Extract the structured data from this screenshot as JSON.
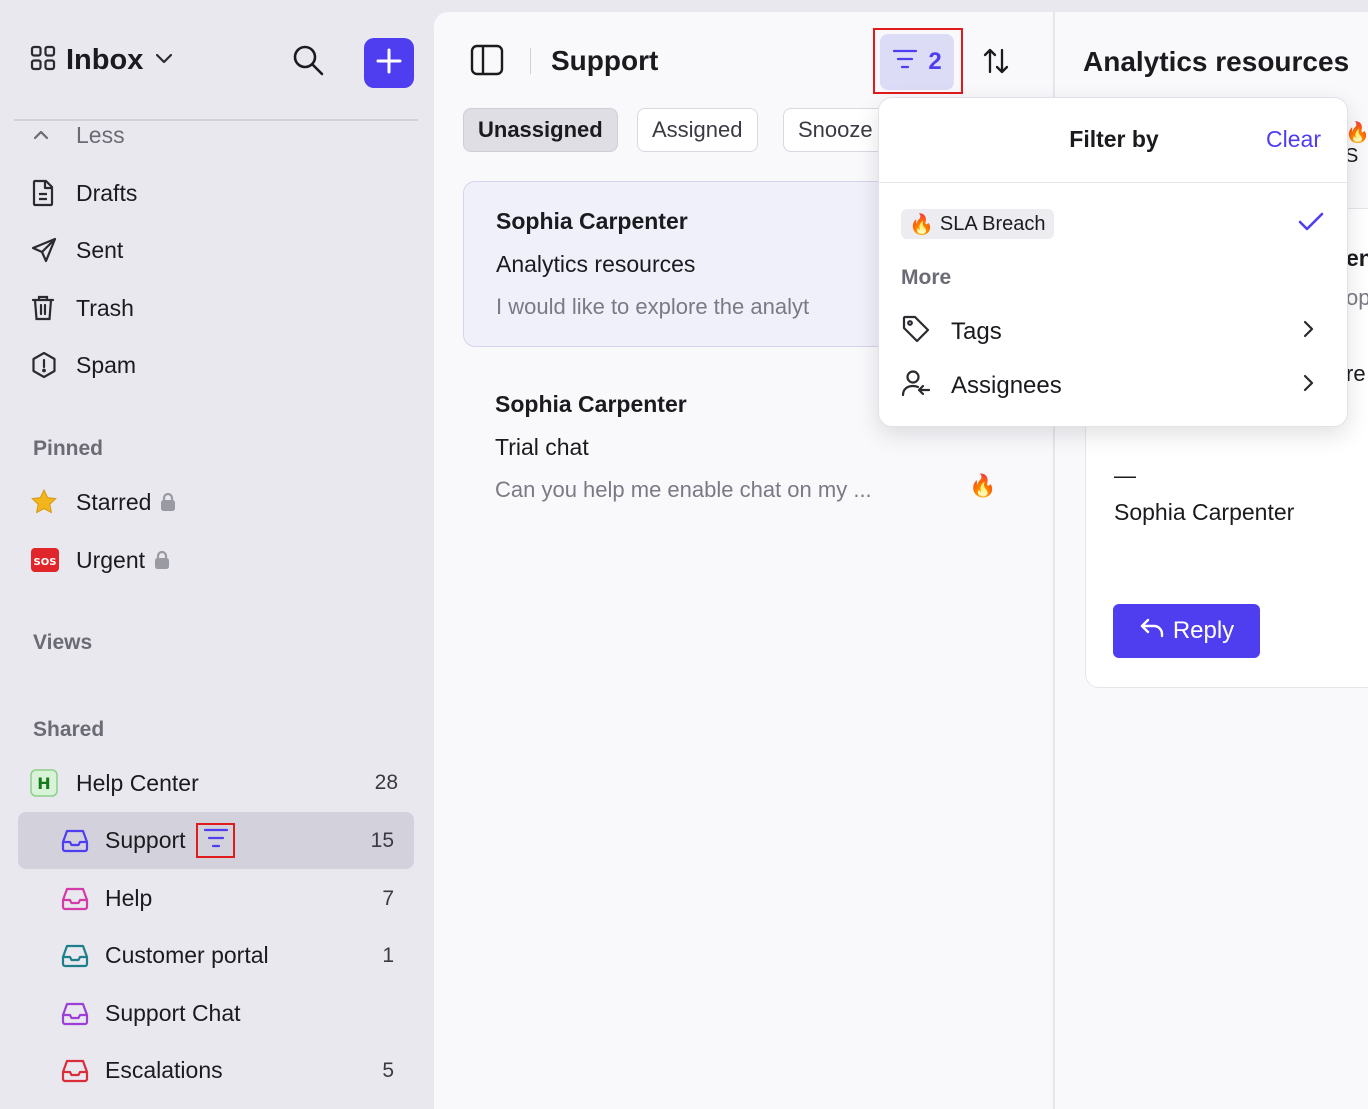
{
  "sidebar": {
    "inbox_title": "Inbox",
    "less_label": "Less",
    "items": [
      {
        "label": "Drafts"
      },
      {
        "label": "Sent"
      },
      {
        "label": "Trash"
      },
      {
        "label": "Spam"
      }
    ],
    "pinned_label": "Pinned",
    "pinned": [
      {
        "label": "Starred"
      },
      {
        "label": "Urgent"
      }
    ],
    "views_label": "Views",
    "shared_label": "Shared",
    "shared": [
      {
        "label": "Help Center",
        "count": "28",
        "badge": "H"
      },
      {
        "label": "Support",
        "count": "15",
        "color": "#4f3df0"
      },
      {
        "label": "Help",
        "count": "7",
        "color": "#d43aa8"
      },
      {
        "label": "Customer portal",
        "count": "1",
        "color": "#1d7f8c"
      },
      {
        "label": "Support Chat",
        "count": "",
        "color": "#9b3fd8"
      },
      {
        "label": "Escalations",
        "count": "5",
        "color": "#d92d3a"
      }
    ]
  },
  "middle": {
    "title": "Support",
    "filter_count": "2",
    "tabs": [
      {
        "label": "Unassigned"
      },
      {
        "label": "Assigned"
      },
      {
        "label": "Snooze"
      }
    ],
    "conversations": [
      {
        "name": "Sophia Carpenter",
        "subject": "Analytics resources",
        "preview": "I would like to explore the analyt"
      },
      {
        "name": "Sophia Carpenter",
        "subject": "Trial chat",
        "preview": "Can you help me enable chat on my ...",
        "emoji": "🔥"
      }
    ]
  },
  "right": {
    "title": "Analytics resources",
    "badge": "🔥 S",
    "frag1": "en",
    "frag2": "op",
    "frag3": "re",
    "signature_dash": "—",
    "signature_name": "Sophia Carpenter",
    "reply_label": "Reply"
  },
  "popover": {
    "title": "Filter by",
    "clear_label": "Clear",
    "chip_emoji": "🔥",
    "chip_label": "SLA Breach",
    "more_label": "More",
    "rows": [
      {
        "label": "Tags"
      },
      {
        "label": "Assignees"
      }
    ]
  },
  "colors": {
    "accent": "#4f3df0",
    "highlight": "#e01b1b"
  }
}
